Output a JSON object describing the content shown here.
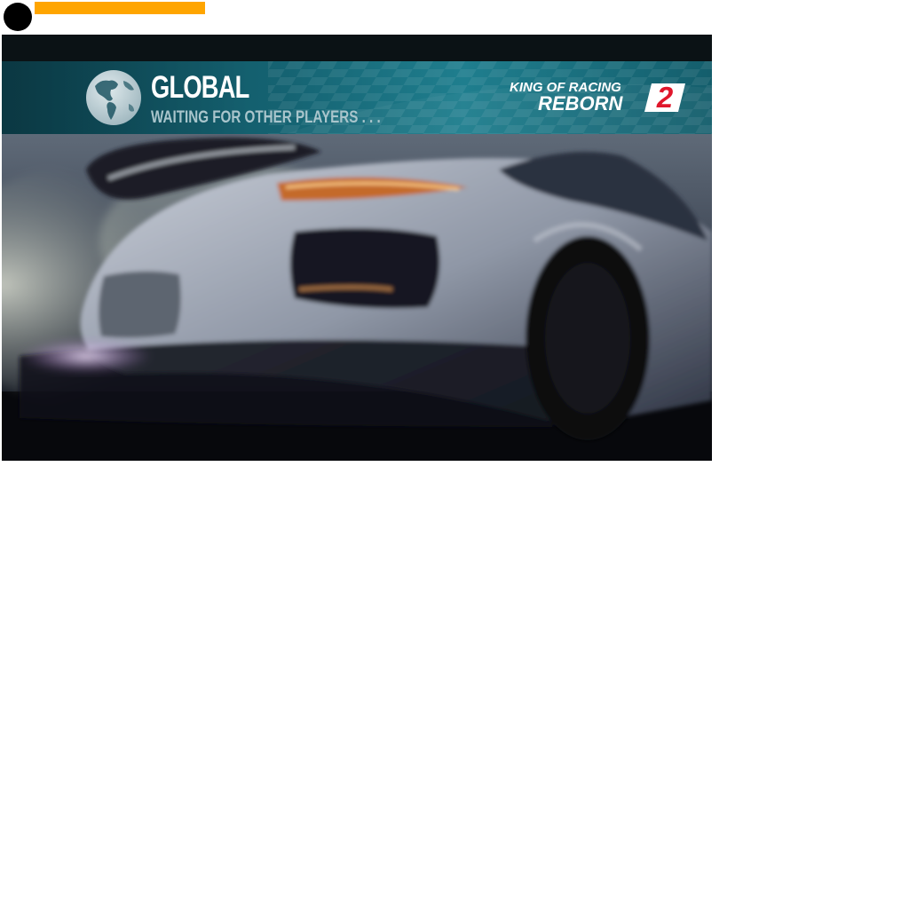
{
  "loading": {
    "progress_fraction": 0.46,
    "progress_color": "#FFA500"
  },
  "banner": {
    "icon": "globe-icon",
    "mode_title": "GLOBAL",
    "status": "WAITING FOR OTHER PLAYERS . . .",
    "accent_color": "#156372"
  },
  "logo": {
    "line1": "KING OF RACING",
    "line2": "REBORN",
    "number": "2",
    "number_color": "#e0162b"
  }
}
